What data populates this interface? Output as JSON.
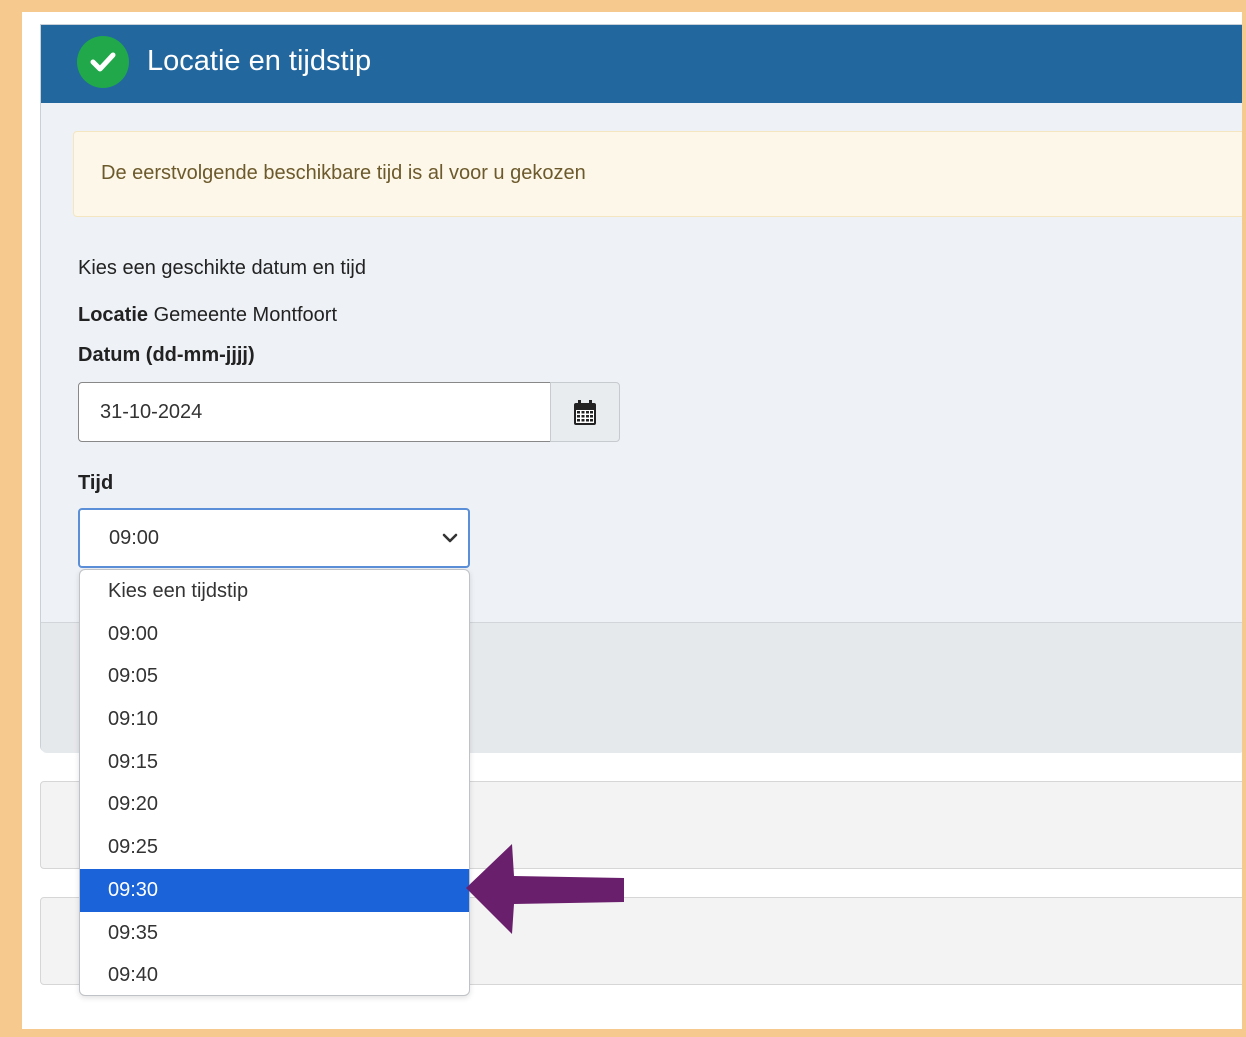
{
  "panel": {
    "title": "Locatie en tijdstip",
    "header_color": "#22679e",
    "status_icon": "check-circle-icon"
  },
  "alert": {
    "text": "De eerstvolgende beschikbare tijd is al voor u gekozen"
  },
  "form": {
    "intro": "Kies een geschikte datum en tijd",
    "location_label": "Locatie",
    "location_value": "Gemeente Montfoort",
    "date_label": "Datum (dd-mm-jjjj)",
    "date_value": "31-10-2024",
    "calendar_icon": "calendar-icon",
    "time_label": "Tijd",
    "time_value": "09:00"
  },
  "dropdown": {
    "options": [
      "Kies een tijdstip",
      "09:00",
      "09:05",
      "09:10",
      "09:15",
      "09:20",
      "09:25",
      "09:30",
      "09:35",
      "09:40"
    ],
    "highlighted": "09:30",
    "highlight_color": "#1a63d8"
  },
  "annotation": {
    "arrow_icon": "arrow-left-icon",
    "arrow_color": "#6a1f6c"
  }
}
